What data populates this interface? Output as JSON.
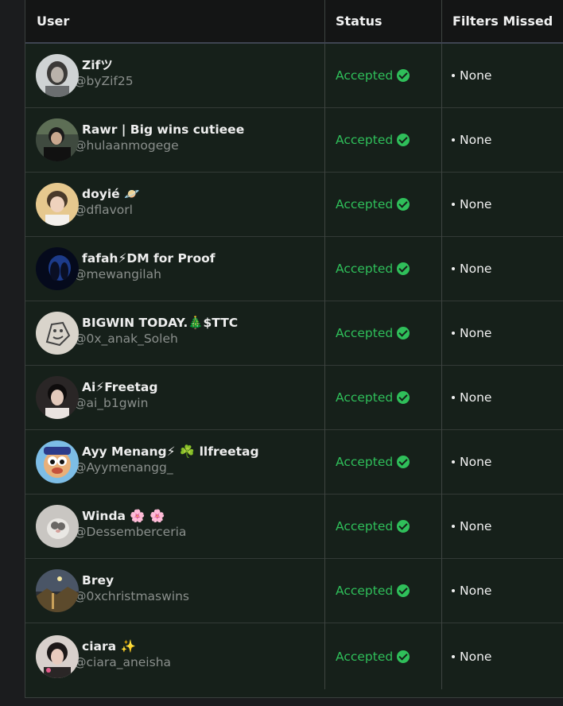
{
  "table": {
    "headers": {
      "user": "User",
      "status": "Status",
      "filters": "Filters Missed"
    },
    "rows": [
      {
        "name": "Zifツ",
        "handle": "@byZif25",
        "status": "Accepted",
        "filters": "None",
        "avatar": "avatar-photo"
      },
      {
        "name": "Rawr | Big wins cutieee",
        "handle": "@hulaanmogege",
        "status": "Accepted",
        "filters": "None",
        "avatar": "avatar-photo"
      },
      {
        "name": "doyié 🪐",
        "handle": "@dflavorl",
        "status": "Accepted",
        "filters": "None",
        "avatar": "avatar-photo"
      },
      {
        "name": "fafah⚡DM for Proof",
        "handle": "@mewangilah",
        "status": "Accepted",
        "filters": "None",
        "avatar": "avatar-photo"
      },
      {
        "name": "BIGWIN TODAY.🎄$TTC",
        "handle": "@0x_anak_Soleh",
        "status": "Accepted",
        "filters": "None",
        "avatar": "avatar-drawing"
      },
      {
        "name": "Ai⚡Freetag",
        "handle": "@ai_b1gwin",
        "status": "Accepted",
        "filters": "None",
        "avatar": "avatar-photo"
      },
      {
        "name": "Ayy Menang⚡ ☘️ llfreetag",
        "handle": "@Ayymenangg_",
        "status": "Accepted",
        "filters": "None",
        "avatar": "avatar-cartoon"
      },
      {
        "name": "Winda 🌸 🌸",
        "handle": "@Dessemberceria",
        "status": "Accepted",
        "filters": "None",
        "avatar": "avatar-cat"
      },
      {
        "name": "Brey",
        "handle": "@0xchristmaswins",
        "status": "Accepted",
        "filters": "None",
        "avatar": "avatar-landscape"
      },
      {
        "name": "ciara ✨",
        "handle": "@ciara_aneisha",
        "status": "Accepted",
        "filters": "None",
        "avatar": "avatar-photo"
      }
    ]
  },
  "colors": {
    "accepted": "#2fbf5a",
    "header_bg": "#141515",
    "row_bg": "#16201a"
  }
}
